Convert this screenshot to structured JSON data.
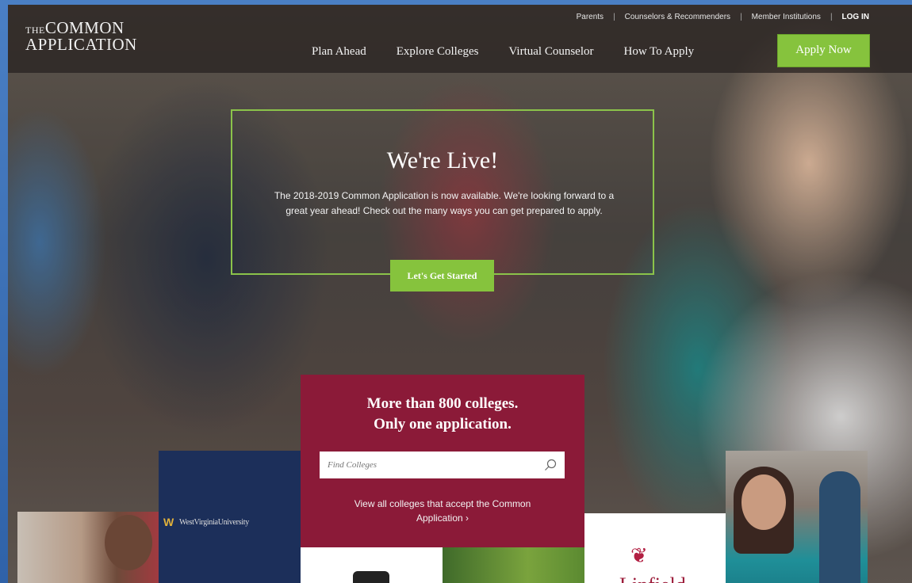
{
  "logo": {
    "line1_prefix": "THE",
    "line1": "COMMON",
    "line2": "APPLICATION"
  },
  "top_links": [
    "Parents",
    "Counselors & Recommenders",
    "Member Institutions"
  ],
  "login": "LOG IN",
  "nav": [
    "Plan Ahead",
    "Explore Colleges",
    "Virtual Counselor",
    "How To Apply"
  ],
  "apply_button": "Apply Now",
  "hero": {
    "title": "We're Live!",
    "text": "The 2018-2019 Common Application is now available. We're looking forward to a great year ahead! Check out the many ways you can get prepared to apply.",
    "cta": "Let's Get Started"
  },
  "college_search": {
    "headline_1": "More than 800 colleges.",
    "headline_2": "Only one application.",
    "placeholder": "Find Colleges",
    "view_all": "View all colleges that accept the Common Application ›"
  },
  "tiles": {
    "wvu_label": "WestVirginiaUniversity",
    "linfield_label": "Linfield"
  },
  "colors": {
    "accent_green": "#86c33d",
    "maroon": "#8b1a38",
    "navy": "#1c2f5a"
  }
}
